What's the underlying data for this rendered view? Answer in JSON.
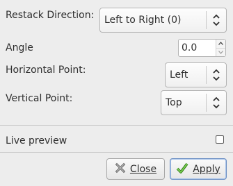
{
  "form": {
    "restack_direction": {
      "label": "Restack Direction:",
      "value": "Left to Right (0)"
    },
    "angle": {
      "label": "Angle",
      "value": "0.0"
    },
    "horizontal_point": {
      "label": "Horizontal Point:",
      "value": "Left"
    },
    "vertical_point": {
      "label": "Vertical Point:",
      "value": "Top"
    }
  },
  "live_preview": {
    "label": "Live preview",
    "checked": false
  },
  "buttons": {
    "close_label": "Close",
    "apply_label": "Apply"
  },
  "icons": {
    "combo_arrows": "chevron-up-down-icon",
    "close": "close-x-icon",
    "apply": "checkmark-icon",
    "spin_up": "spin-up-icon",
    "spin_down": "spin-down-icon"
  },
  "colors": {
    "window_bg": "#ededed",
    "apply_check": "#4caf2a",
    "apply_border": "#6c8fc4"
  }
}
